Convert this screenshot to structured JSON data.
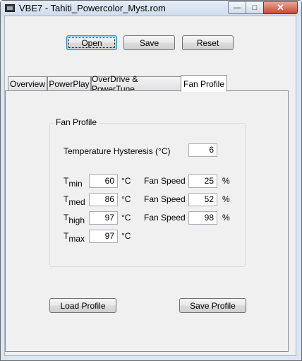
{
  "window": {
    "title": "VBE7 - Tahiti_Powercolor_Myst.rom",
    "min_glyph": "—",
    "max_glyph": "□",
    "close_glyph": "✕"
  },
  "toolbar": {
    "open": "Open",
    "save": "Save",
    "reset": "Reset"
  },
  "tabs": [
    "Overview",
    "PowerPlay",
    "OverDrive & PowerTune",
    "Fan Profile"
  ],
  "active_tab": "Fan Profile",
  "fan_profile": {
    "group_title": "Fan Profile",
    "hysteresis_label": "Temperature Hysteresis (°C)",
    "hysteresis_value": "6",
    "temp_unit": "°C",
    "fan_speed_label": "Fan Speed",
    "percent_unit": "%",
    "rows": [
      {
        "t": "T",
        "sub": "min",
        "temp": "60",
        "speed": "25"
      },
      {
        "t": "T",
        "sub": "med",
        "temp": "86",
        "speed": "52"
      },
      {
        "t": "T",
        "sub": "high",
        "temp": "97",
        "speed": "98"
      },
      {
        "t": "T",
        "sub": "max",
        "temp": "97"
      }
    ]
  },
  "buttons": {
    "load_profile": "Load Profile",
    "save_profile": "Save Profile"
  }
}
